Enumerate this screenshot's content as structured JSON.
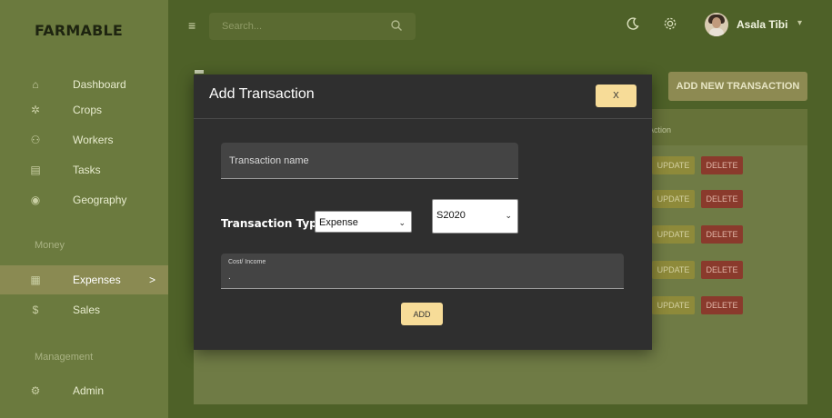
{
  "brand": "FARMABLE",
  "sidebar": {
    "items": [
      {
        "label": "Dashboard",
        "icon": "home-icon"
      },
      {
        "label": "Crops",
        "icon": "plant-icon"
      },
      {
        "label": "Workers",
        "icon": "users-icon"
      },
      {
        "label": "Tasks",
        "icon": "clipboard-icon"
      },
      {
        "label": "Geography",
        "icon": "globe-icon"
      }
    ],
    "money_section": "Money",
    "money_items": [
      {
        "label": "Expenses",
        "icon": "calendar-icon",
        "chevron": ">"
      },
      {
        "label": "Sales",
        "icon": "dollar-icon"
      }
    ],
    "management_section": "Management",
    "management_items": [
      {
        "label": "Admin",
        "icon": "admin-icon"
      }
    ]
  },
  "header": {
    "search_placeholder": "Search...",
    "user_name": "Asala Tibi"
  },
  "content": {
    "add_new_label": "ADD NEW TRANSACTION",
    "action_header": "Action",
    "update_label": "UPDATE",
    "delete_label": "DELETE"
  },
  "modal": {
    "title": "Add Transaction",
    "close_label": "X",
    "name_placeholder": "Transaction name",
    "type_label": "Transaction Type",
    "type_value": "Expense",
    "season_value": "S2020",
    "cost_label": "Cost/ Income",
    "cost_value": ".",
    "add_label": "ADD"
  },
  "colors": {
    "accent": "#f7dc98",
    "modal_bg": "#2f2f2f",
    "sidebar_bg": "#6b7a3e",
    "page_bg": "#4e6128",
    "delete": "#8a3a2c",
    "update": "#8e8a3a"
  }
}
